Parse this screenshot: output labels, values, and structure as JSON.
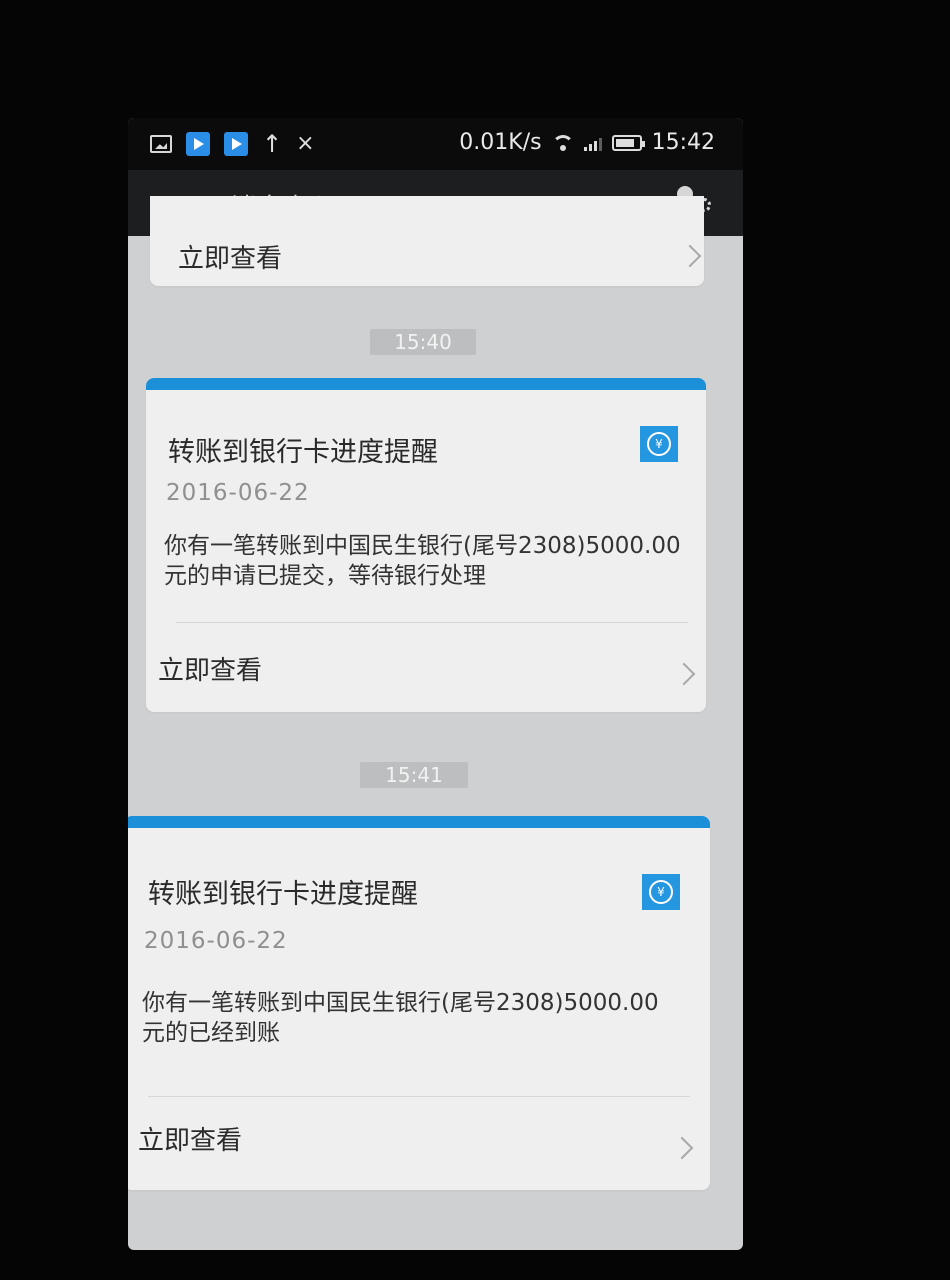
{
  "status_bar": {
    "speed": "0.01K/s",
    "time": "15:42"
  },
  "nav": {
    "title": "消息中心"
  },
  "partial_card": {
    "action": "立即查看"
  },
  "messages": [
    {
      "time": "15:40",
      "title": "转账到银行卡进度提醒",
      "date": "2016-06-22",
      "body_line1": "你有一笔转账到中国民生银行(尾号2308)5000.00",
      "body_line2": "元的申请已提交，等待银行处理",
      "action": "立即查看"
    },
    {
      "time": "15:41",
      "title": "转账到银行卡进度提醒",
      "date": "2016-06-22",
      "body_line1": "你有一笔转账到中国民生银行(尾号2308)5000.00",
      "body_line2": "元的已经到账",
      "action": "立即查看"
    }
  ],
  "colors": {
    "accent": "#1c8fd9",
    "icon_bg": "#2596e0",
    "background": "#cfd0d2"
  },
  "icons": {
    "back": "arrow-left",
    "settings": "user-gear",
    "message_type": "yen-transfer"
  }
}
